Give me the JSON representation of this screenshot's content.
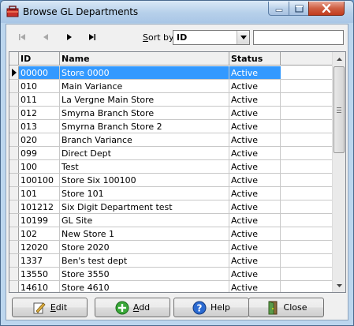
{
  "window": {
    "title": "Browse GL Departments",
    "controls": {
      "minimize": "minimize-icon",
      "maximize": "maximize-icon",
      "close": "close-icon"
    }
  },
  "toolbar": {
    "nav": [
      "first-record-icon",
      "previous-record-icon",
      "next-record-icon",
      "last-record-icon"
    ],
    "sort_by_label_prefix": "S",
    "sort_by_label_rest": "ort by",
    "sort_by_value": "ID",
    "search_value": ""
  },
  "grid": {
    "columns": [
      "ID",
      "Name",
      "Status"
    ],
    "rows": [
      {
        "id": "00000",
        "name": "Store 0000",
        "status": "Active"
      },
      {
        "id": "010",
        "name": "Main Variance",
        "status": "Active"
      },
      {
        "id": "011",
        "name": "La Vergne Main Store",
        "status": "Active"
      },
      {
        "id": "012",
        "name": "Smyrna Branch Store",
        "status": "Active"
      },
      {
        "id": "013",
        "name": "Smyrna Branch Store 2",
        "status": "Active"
      },
      {
        "id": "020",
        "name": "Branch Variance",
        "status": "Active"
      },
      {
        "id": "099",
        "name": "Direct Dept",
        "status": "Active"
      },
      {
        "id": "100",
        "name": "Test",
        "status": "Active"
      },
      {
        "id": "100100",
        "name": "Store Six 100100",
        "status": "Active"
      },
      {
        "id": "101",
        "name": "Store 101",
        "status": "Active"
      },
      {
        "id": "101212",
        "name": "Six Digit Department test",
        "status": "Active"
      },
      {
        "id": "10199",
        "name": "GL Site",
        "status": "Active"
      },
      {
        "id": "102",
        "name": "New Store 1",
        "status": "Active"
      },
      {
        "id": "12020",
        "name": "Store 2020",
        "status": "Active"
      },
      {
        "id": "1337",
        "name": "Ben's test dept",
        "status": "Active"
      },
      {
        "id": "13550",
        "name": "Store 3550",
        "status": "Active"
      },
      {
        "id": "14610",
        "name": "Store 4610",
        "status": "Active"
      }
    ],
    "selected_index": 0
  },
  "buttons": {
    "edit": {
      "u": "E",
      "rest": "dit",
      "icon": "edit-icon"
    },
    "add": {
      "u": "A",
      "rest": "dd",
      "icon": "add-icon"
    },
    "help": {
      "label": "Help",
      "icon": "help-icon"
    },
    "close": {
      "label": "Close",
      "icon": "door-icon"
    }
  },
  "colors": {
    "selection": "#3399ff",
    "title_bar": "#b6d0ea",
    "close_button": "#c23b1c"
  }
}
